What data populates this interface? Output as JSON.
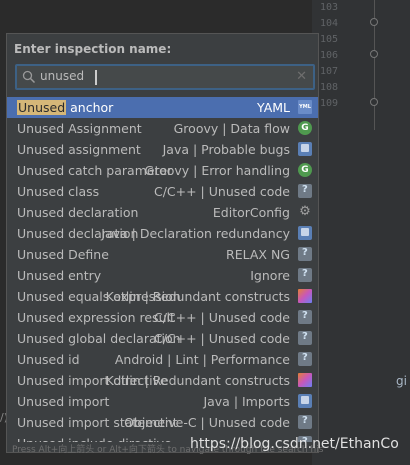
{
  "gutter": {
    "line_numbers": [
      "103",
      "104",
      "105",
      "106",
      "107",
      "108",
      "109"
    ]
  },
  "right_edge_text": "gi",
  "left_edge_text": "/)",
  "popup": {
    "title": "Enter inspection name:",
    "search": {
      "value": "unused",
      "icon": "search-icon",
      "clear_icon": "clear-icon"
    },
    "items": [
      {
        "highlight": "Unused",
        "rest": " anchor",
        "category": "YAML",
        "icon": "yaml-icon",
        "selected": true
      },
      {
        "highlight": "",
        "rest": "Unused Assignment",
        "category": "Groovy | Data flow",
        "icon": "groovy-icon",
        "selected": false
      },
      {
        "highlight": "",
        "rest": "Unused assignment",
        "category": "Java | Probable bugs",
        "icon": "java-icon",
        "selected": false
      },
      {
        "highlight": "",
        "rest": "Unused catch parameter",
        "category": "Groovy | Error handling",
        "icon": "groovy-icon",
        "selected": false
      },
      {
        "highlight": "",
        "rest": "Unused class",
        "category": "C/C++ | Unused code",
        "icon": "generic-inspection-icon",
        "selected": false
      },
      {
        "highlight": "",
        "rest": "Unused declaration",
        "category": "EditorConfig",
        "icon": "gear-icon",
        "selected": false
      },
      {
        "highlight": "",
        "rest": "Unused declaration",
        "category": "Java | Declaration redundancy",
        "icon": "java-icon",
        "selected": false
      },
      {
        "highlight": "",
        "rest": "Unused Define",
        "category": "RELAX NG",
        "icon": "generic-inspection-icon",
        "selected": false
      },
      {
        "highlight": "",
        "rest": "Unused entry",
        "category": "Ignore",
        "icon": "generic-inspection-icon",
        "selected": false
      },
      {
        "highlight": "",
        "rest": "Unused equals expression",
        "category": "Kotlin | Redundant constructs",
        "icon": "kotlin-icon",
        "selected": false
      },
      {
        "highlight": "",
        "rest": "Unused expression result",
        "category": "C/C++ | Unused code",
        "icon": "generic-inspection-icon",
        "selected": false
      },
      {
        "highlight": "",
        "rest": "Unused global declaration",
        "category": "C/C++ | Unused code",
        "icon": "generic-inspection-icon",
        "selected": false
      },
      {
        "highlight": "",
        "rest": "Unused id",
        "category": "Android | Lint | Performance",
        "icon": "android-icon",
        "selected": false
      },
      {
        "highlight": "",
        "rest": "Unused import directive",
        "category": "Kotlin | Redundant constructs",
        "icon": "kotlin-icon",
        "selected": false
      },
      {
        "highlight": "",
        "rest": "Unused import",
        "category": "Java | Imports",
        "icon": "java-icon",
        "selected": false
      },
      {
        "highlight": "",
        "rest": "Unused import statement",
        "category": "Objective-C | Unused code",
        "icon": "generic-inspection-icon",
        "selected": false
      },
      {
        "highlight": "",
        "rest": "Unused include directive",
        "category": "",
        "icon": "generic-inspection-icon",
        "selected": false
      }
    ],
    "footer_hint": "Press Alt+向上箭头 or Alt+向下箭头 to navigate through the search history"
  },
  "watermark": "https://blog.csdn.net/EthanCo"
}
